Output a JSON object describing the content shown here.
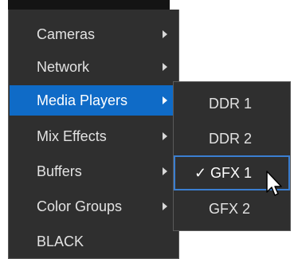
{
  "menu": {
    "items": [
      {
        "label": "Cameras",
        "has_submenu": true,
        "active": false
      },
      {
        "label": "Network",
        "has_submenu": true,
        "active": false
      },
      {
        "label": "Media Players",
        "has_submenu": true,
        "active": true
      },
      {
        "label": "Mix Effects",
        "has_submenu": true,
        "active": false
      },
      {
        "label": "Buffers",
        "has_submenu": true,
        "active": false
      },
      {
        "label": "Color Groups",
        "has_submenu": true,
        "active": false
      },
      {
        "label": "BLACK",
        "has_submenu": false,
        "active": false
      }
    ]
  },
  "submenu": {
    "items": [
      {
        "label": "DDR 1",
        "checked": false
      },
      {
        "label": "DDR 2",
        "checked": false
      },
      {
        "label": "GFX 1",
        "checked": true
      },
      {
        "label": "GFX 2",
        "checked": false
      }
    ],
    "check_mark": "✓"
  },
  "colors": {
    "menu_bg": "#2f2f2f",
    "highlight": "#0f6bc7",
    "checked_border": "#3b7fd1",
    "text": "#e2e2e2"
  },
  "icons": {
    "submenu_arrow": "caret-right-icon",
    "pointer": "mouse-cursor-icon"
  }
}
